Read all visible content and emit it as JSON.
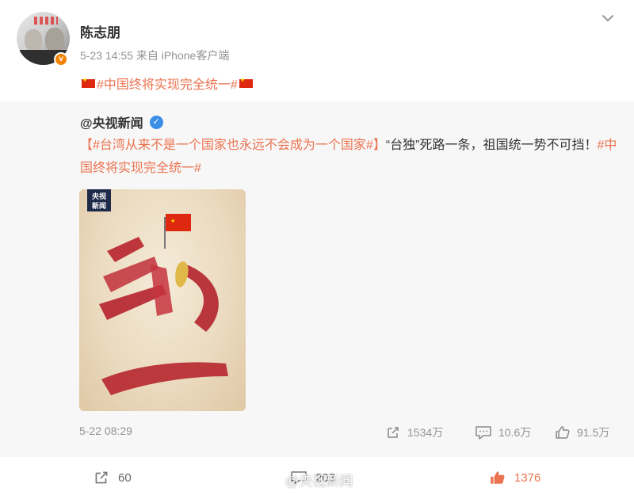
{
  "post": {
    "username": "陈志朋",
    "meta": "5-23 14:55 来自 iPhone客户端",
    "topic_text": "#中国终将实现完全统一#"
  },
  "repost": {
    "author": "@央视新闻",
    "bracket_open": "【",
    "topic1": "#台湾从来不是一个国家也永远不会成为一个国家#",
    "bracket_close": "】",
    "body_text": "“台独”死路一条，祖国统一势不可挡！",
    "topic2": "#中国终将实现完全统一#",
    "image": {
      "logo_line1": "央视",
      "logo_line2": "新闻",
      "big_char_top": "统",
      "big_char_bottom": "一"
    },
    "time": "5-22 08:29",
    "reposts": "1534万",
    "comments": "10.6万",
    "likes": "91.5万"
  },
  "actions": {
    "repost_count": "60",
    "comment_count": "203",
    "like_count": "1376",
    "watermark_text": "@央视新闻"
  },
  "colors": {
    "accent": "#eb7350",
    "muted": "#939393",
    "repost_bg": "#f7f7f7",
    "verified_blue": "#3a8ee6",
    "v_orange": "#f38200"
  }
}
